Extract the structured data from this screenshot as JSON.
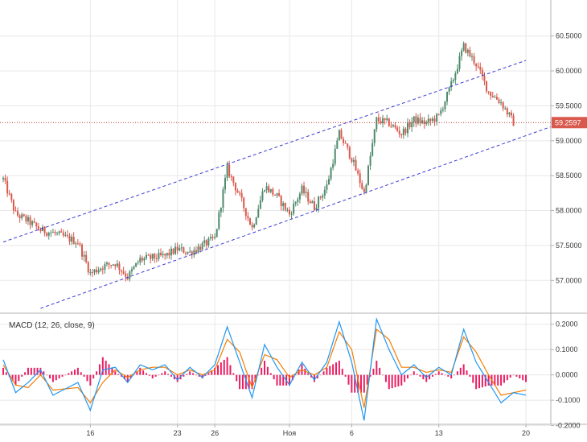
{
  "colors": {
    "up": "#4f8a6d",
    "down": "#d9594c",
    "channel": "#3b3bd6",
    "price_line": "#c0392b",
    "price_tag": "#d9594c",
    "macd": "#2196f3",
    "signal": "#f57c00",
    "hist": "#e91e63",
    "grid": "#e8e8e8",
    "axis": "#b0b0b0"
  },
  "chart_data": [
    {
      "type": "candlestick",
      "panel": "price",
      "x_axis": {
        "start": "2018-10-09",
        "end": "2018-11-22",
        "ticks": [
          {
            "date": "2018-10-16",
            "label": "16"
          },
          {
            "date": "2018-10-23",
            "label": "23"
          },
          {
            "date": "2018-10-26",
            "label": "26"
          },
          {
            "date": "2018-11-01",
            "label": "Ноя"
          },
          {
            "date": "2018-11-06",
            "label": "6"
          },
          {
            "date": "2018-11-13",
            "label": "13"
          },
          {
            "date": "2018-11-20",
            "label": "20"
          }
        ]
      },
      "y_axis": {
        "range": [
          56.6,
          60.9
        ],
        "ticks": [
          "60.5000",
          "60.0000",
          "59.5000",
          "59.0000",
          "58.5000",
          "58.0000",
          "57.5000",
          "57.0000"
        ]
      },
      "last_price": "59.2597",
      "grid": true,
      "close_path": [
        [
          "2018-10-09",
          58.45
        ],
        [
          "2018-10-10",
          57.95
        ],
        [
          "2018-10-11",
          57.85
        ],
        [
          "2018-10-12",
          57.72
        ],
        [
          "2018-10-13",
          57.68
        ],
        [
          "2018-10-15",
          57.55
        ],
        [
          "2018-10-16",
          57.1
        ],
        [
          "2018-10-17",
          57.2
        ],
        [
          "2018-10-18",
          57.25
        ],
        [
          "2018-10-19",
          57.05
        ],
        [
          "2018-10-20",
          57.3
        ],
        [
          "2018-10-22",
          57.35
        ],
        [
          "2018-10-23",
          57.45
        ],
        [
          "2018-10-24",
          57.4
        ],
        [
          "2018-10-25",
          57.5
        ],
        [
          "2018-10-26",
          57.6
        ],
        [
          "2018-10-27",
          58.6
        ],
        [
          "2018-10-28",
          58.2
        ],
        [
          "2018-10-29",
          57.75
        ],
        [
          "2018-10-30",
          58.35
        ],
        [
          "2018-10-31",
          58.2
        ],
        [
          "2018-11-01",
          57.95
        ],
        [
          "2018-11-02",
          58.3
        ],
        [
          "2018-11-03",
          58.05
        ],
        [
          "2018-11-04",
          58.35
        ],
        [
          "2018-11-05",
          59.1
        ],
        [
          "2018-11-06",
          58.75
        ],
        [
          "2018-11-07",
          58.25
        ],
        [
          "2018-11-08",
          59.3
        ],
        [
          "2018-11-09",
          59.25
        ],
        [
          "2018-11-10",
          59.1
        ],
        [
          "2018-11-11",
          59.3
        ],
        [
          "2018-11-12",
          59.25
        ],
        [
          "2018-11-13",
          59.35
        ],
        [
          "2018-11-14",
          59.8
        ],
        [
          "2018-11-15",
          60.35
        ],
        [
          "2018-11-16",
          60.1
        ],
        [
          "2018-11-17",
          59.7
        ],
        [
          "2018-11-18",
          59.55
        ],
        [
          "2018-11-19",
          59.26
        ]
      ],
      "trend_channel": [
        {
          "from": [
            "2018-10-09",
            57.55
          ],
          "to": [
            "2018-11-20",
            60.15
          ]
        },
        {
          "from": [
            "2018-10-12",
            56.6
          ],
          "to": [
            "2018-11-22",
            59.2
          ]
        }
      ]
    },
    {
      "type": "line",
      "panel": "macd",
      "title": "MACD (12, 26, close, 9)",
      "y_axis": {
        "range": [
          -0.195,
          0.215
        ],
        "ticks": [
          "0.2000",
          "0.1000",
          "0.0000",
          "-0.1000",
          "-0.2000"
        ]
      },
      "series": [
        {
          "role": "macd",
          "values": [
            [
              "2018-10-09",
              0.06
            ],
            [
              "2018-10-10",
              -0.07
            ],
            [
              "2018-10-11",
              -0.03
            ],
            [
              "2018-10-12",
              0.02
            ],
            [
              "2018-10-13",
              -0.08
            ],
            [
              "2018-10-15",
              -0.03
            ],
            [
              "2018-10-16",
              -0.14
            ],
            [
              "2018-10-17",
              0.02
            ],
            [
              "2018-10-18",
              0.03
            ],
            [
              "2018-10-19",
              -0.03
            ],
            [
              "2018-10-20",
              0.04
            ],
            [
              "2018-10-21",
              0.02
            ],
            [
              "2018-10-22",
              0.04
            ],
            [
              "2018-10-23",
              -0.02
            ],
            [
              "2018-10-24",
              0.03
            ],
            [
              "2018-10-25",
              -0.01
            ],
            [
              "2018-10-26",
              0.04
            ],
            [
              "2018-10-27",
              0.19
            ],
            [
              "2018-10-28",
              0.05
            ],
            [
              "2018-10-29",
              -0.09
            ],
            [
              "2018-10-30",
              0.12
            ],
            [
              "2018-10-31",
              0.03
            ],
            [
              "2018-11-01",
              -0.04
            ],
            [
              "2018-11-02",
              0.05
            ],
            [
              "2018-11-03",
              -0.02
            ],
            [
              "2018-11-04",
              0.05
            ],
            [
              "2018-11-05",
              0.21
            ],
            [
              "2018-11-06",
              0.05
            ],
            [
              "2018-11-07",
              -0.18
            ],
            [
              "2018-11-08",
              0.22
            ],
            [
              "2018-11-09",
              0.1
            ],
            [
              "2018-11-10",
              0.0
            ],
            [
              "2018-11-11",
              0.04
            ],
            [
              "2018-11-12",
              -0.01
            ],
            [
              "2018-11-13",
              0.03
            ],
            [
              "2018-11-14",
              0.0
            ],
            [
              "2018-11-15",
              0.18
            ],
            [
              "2018-11-16",
              0.05
            ],
            [
              "2018-11-17",
              -0.03
            ],
            [
              "2018-11-18",
              -0.11
            ],
            [
              "2018-11-19",
              -0.07
            ],
            [
              "2018-11-20",
              -0.08
            ]
          ]
        },
        {
          "role": "signal",
          "values": [
            [
              "2018-10-09",
              0.04
            ],
            [
              "2018-10-10",
              -0.04
            ],
            [
              "2018-10-11",
              -0.05
            ],
            [
              "2018-10-12",
              0.0
            ],
            [
              "2018-10-13",
              -0.06
            ],
            [
              "2018-10-15",
              -0.05
            ],
            [
              "2018-10-16",
              -0.11
            ],
            [
              "2018-10-17",
              -0.03
            ],
            [
              "2018-10-18",
              0.02
            ],
            [
              "2018-10-19",
              -0.01
            ],
            [
              "2018-10-20",
              0.02
            ],
            [
              "2018-10-21",
              0.03
            ],
            [
              "2018-10-22",
              0.03
            ],
            [
              "2018-10-23",
              0.0
            ],
            [
              "2018-10-24",
              0.02
            ],
            [
              "2018-10-25",
              0.0
            ],
            [
              "2018-10-26",
              0.02
            ],
            [
              "2018-10-27",
              0.14
            ],
            [
              "2018-10-28",
              0.09
            ],
            [
              "2018-10-29",
              -0.05
            ],
            [
              "2018-10-30",
              0.08
            ],
            [
              "2018-10-31",
              0.06
            ],
            [
              "2018-11-01",
              -0.01
            ],
            [
              "2018-11-02",
              0.02
            ],
            [
              "2018-11-03",
              0.0
            ],
            [
              "2018-11-04",
              0.03
            ],
            [
              "2018-11-05",
              0.17
            ],
            [
              "2018-11-06",
              0.1
            ],
            [
              "2018-11-07",
              -0.13
            ],
            [
              "2018-11-08",
              0.18
            ],
            [
              "2018-11-09",
              0.14
            ],
            [
              "2018-11-10",
              0.03
            ],
            [
              "2018-11-11",
              0.03
            ],
            [
              "2018-11-12",
              0.01
            ],
            [
              "2018-11-13",
              0.02
            ],
            [
              "2018-11-14",
              0.01
            ],
            [
              "2018-11-15",
              0.15
            ],
            [
              "2018-11-16",
              0.09
            ],
            [
              "2018-11-17",
              0.0
            ],
            [
              "2018-11-18",
              -0.08
            ],
            [
              "2018-11-19",
              -0.07
            ],
            [
              "2018-11-20",
              -0.06
            ]
          ]
        }
      ],
      "histogram_visible": true,
      "grid": true
    }
  ]
}
